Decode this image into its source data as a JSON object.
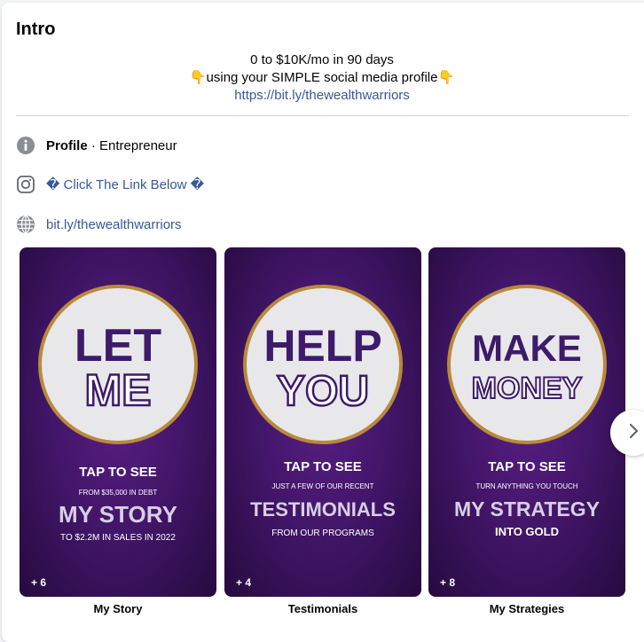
{
  "intro": {
    "title": "Intro",
    "bio_line1": "0 to $10K/mo in 90 days",
    "bio_line2": "👇using your SIMPLE social media profile👇",
    "bio_link": "https://bit.ly/thewealthwarriors"
  },
  "details": {
    "profile_label": "Profile",
    "profile_separator": " · ",
    "profile_category": "Entrepreneur",
    "instagram_text": "� Click The Link Below �",
    "website_text": "bit.ly/thewealthwarriors"
  },
  "highlights": [
    {
      "label": "My Story",
      "count": "+ 6",
      "word1": "LET",
      "word2": "ME",
      "tap": "TAP TO SEE",
      "sub1": "FROM $35,000 IN DEBT",
      "big": "MY STORY",
      "sub2": "TO $2.2M IN SALES IN 2022"
    },
    {
      "label": "Testimonials",
      "count": "+ 4",
      "word1": "HELP",
      "word2": "YOU",
      "tap": "TAP TO SEE",
      "sub1": "JUST A FEW OF OUR RECENT",
      "big": "TESTIMONIALS",
      "sub2": "FROM OUR PROGRAMS"
    },
    {
      "label": "My Strategies",
      "count": "+ 8",
      "word1": "MAKE",
      "word2": "MONEY",
      "tap": "TAP TO SEE",
      "sub1": "TURN ANYTHING YOU TOUCH",
      "big": "MY STRATEGY",
      "sub2": "INTO GOLD"
    }
  ],
  "colors": {
    "link": "#385898",
    "highlight_purple": "#43166a",
    "word_purple": "#3e1a6b",
    "gold_ring": "#b88a3a"
  },
  "icons": {
    "profile": "info-icon",
    "instagram": "instagram-icon",
    "website": "globe-icon",
    "next": "chevron-right-icon"
  }
}
